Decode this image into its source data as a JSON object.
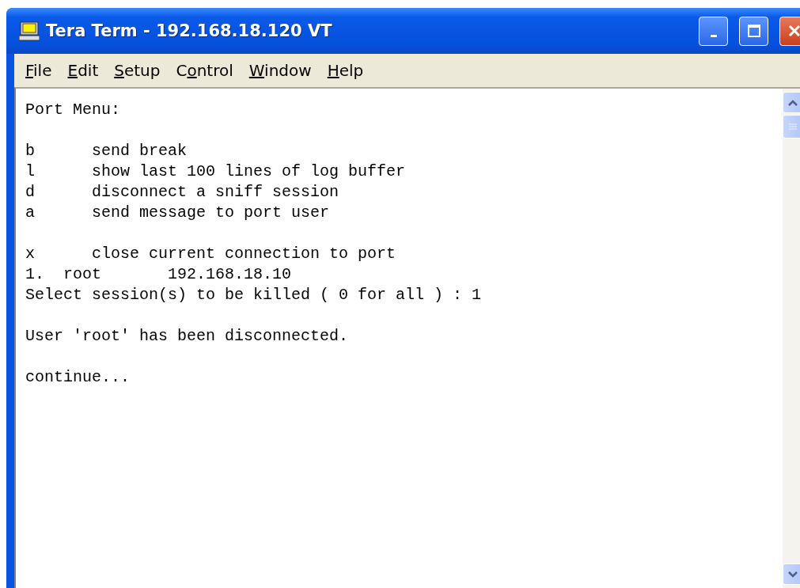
{
  "window": {
    "title": "Tera Term - 192.168.18.120 VT"
  },
  "menu": [
    {
      "key": "F",
      "after": "ile"
    },
    {
      "key": "E",
      "after": "dit"
    },
    {
      "key": "S",
      "after": "etup"
    },
    {
      "before": "C",
      "key": "o",
      "after": "ntrol"
    },
    {
      "key": "W",
      "after": "indow"
    },
    {
      "key": "H",
      "after": "elp"
    }
  ],
  "terminal": {
    "blocks": [
      {
        "lines": [
          "Port Menu:"
        ]
      },
      {
        "lines": [
          "b      send break",
          "l      show last 100 lines of log buffer",
          "d      disconnect a sniff session",
          "a      send message to port user"
        ]
      },
      {
        "lines": [
          "x      close current connection to port",
          "1.  root       192.168.18.10",
          "Select session(s) to be killed ( 0 for all ) : 1"
        ]
      },
      {
        "lines": [
          "User 'root' has been disconnected."
        ]
      },
      {
        "lines": [
          "continue..."
        ]
      }
    ]
  }
}
